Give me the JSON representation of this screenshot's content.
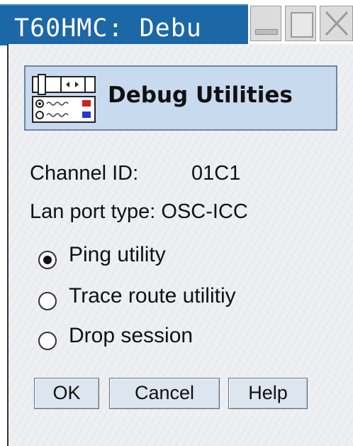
{
  "window": {
    "title": "T60HMC: Debu"
  },
  "header": {
    "title": "Debug Utilities",
    "icon": "channel-adapter-icon"
  },
  "info": {
    "channel_label": "Channel ID:",
    "channel_value": "01C1",
    "lan_label": "Lan port type:",
    "lan_value": "OSC-ICC"
  },
  "options": [
    {
      "label": "Ping utility",
      "selected": true
    },
    {
      "label": "Trace route utilitiy",
      "selected": false
    },
    {
      "label": "Drop session",
      "selected": false
    }
  ],
  "buttons": {
    "ok": "OK",
    "cancel": "Cancel",
    "help": "Help"
  },
  "colors": {
    "titlebar": "#1c67a6",
    "header_panel": "#c8daee"
  }
}
